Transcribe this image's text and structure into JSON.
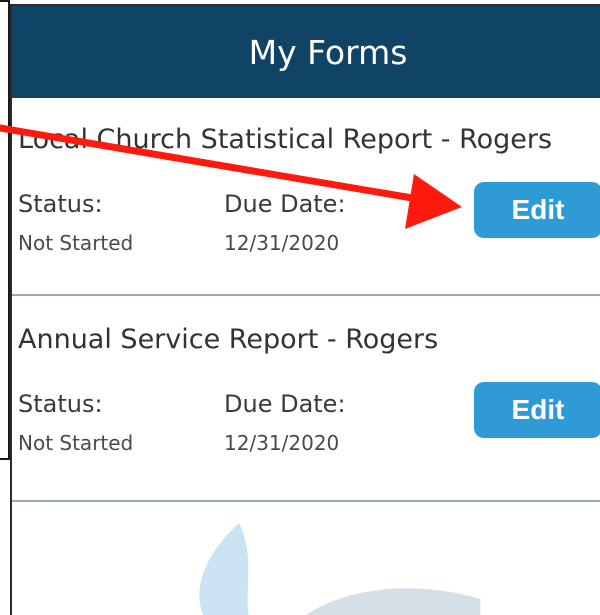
{
  "header": {
    "title": "My Forms"
  },
  "forms": [
    {
      "title": "Local Church Statistical Report - Rogers",
      "status_label": "Status:",
      "status_value": "Not Started",
      "due_label": "Due Date:",
      "due_value": "12/31/2020",
      "action_label": "Edit"
    },
    {
      "title": "Annual Service Report - Rogers",
      "status_label": "Status:",
      "status_value": "Not Started",
      "due_label": "Due Date:",
      "due_value": "12/31/2020",
      "action_label": "Edit"
    }
  ],
  "theme": {
    "header_color": "#0f4467",
    "button_color": "#2e9ad6",
    "annotation_color": "#ff1a0f",
    "watermark_color": "#9fcbe8"
  }
}
